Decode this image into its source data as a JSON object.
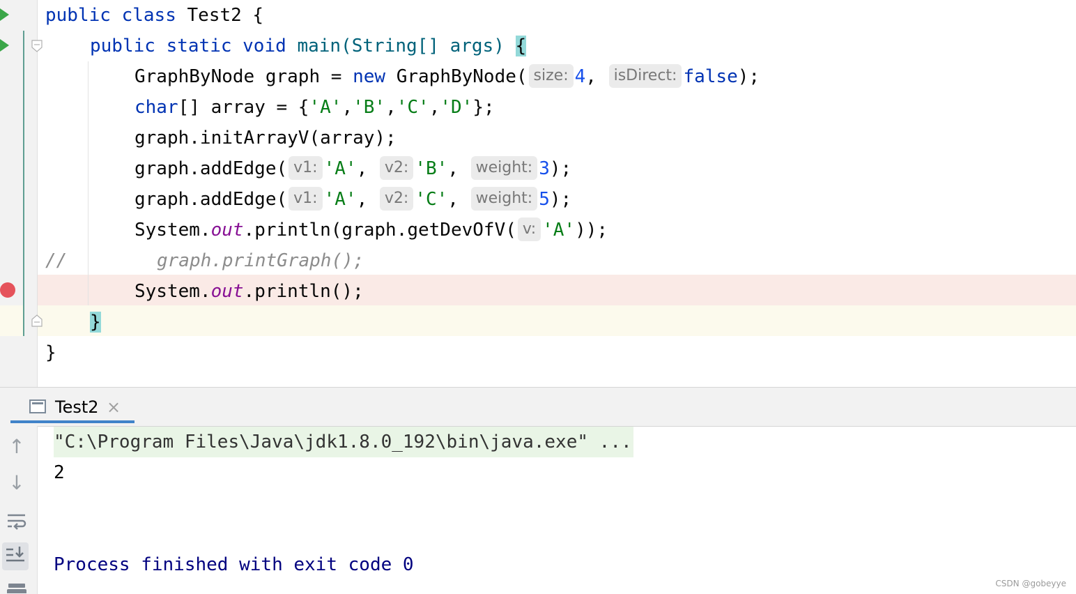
{
  "editor": {
    "line1": {
      "kw1": "public",
      "kw2": "class",
      "name": "Test2 {"
    },
    "line2": {
      "kw1": "public",
      "kw2": "static",
      "kw3": "void",
      "rest": "main(String[] args) ",
      "brace": "{"
    },
    "line3": {
      "pre": "GraphByNode graph = ",
      "kw": "new",
      "call": " GraphByNode(",
      "hint1": "size:",
      "num1": "4",
      "sep": ", ",
      "hint2": "isDirect:",
      "kw2": "false",
      "end": ");"
    },
    "line4": {
      "kw": "char",
      "pre": "[] array = {",
      "s1": "'A'",
      "s2": "'B'",
      "s3": "'C'",
      "s4": "'D'",
      "comma": ",",
      "end": "};"
    },
    "line5": {
      "text": "graph.initArrayV(array);"
    },
    "line6": {
      "pre": "graph.addEdge(",
      "h1": "v1:",
      "a1": "'A'",
      "h2": "v2:",
      "a2": "'B'",
      "h3": "weight:",
      "a3": "3",
      "comma": ", ",
      "end": ");"
    },
    "line7": {
      "pre": "graph.addEdge(",
      "h1": "v1:",
      "a1": "'A'",
      "h2": "v2:",
      "a2": "'C'",
      "h3": "weight:",
      "a3": "5",
      "comma": ", ",
      "end": ");"
    },
    "line8": {
      "pre": "System.",
      "fld": "out",
      "mid": ".println(graph.getDevOfV(",
      "h1": "v:",
      "a1": "'A'",
      "end": "));"
    },
    "line9": {
      "slashes": "//",
      "text": "graph.printGraph();"
    },
    "line10": {
      "pre": "System.",
      "fld": "out",
      "end": ".println();"
    },
    "line11": {
      "brace": "}"
    },
    "line12": {
      "brace": "}"
    }
  },
  "run_panel": {
    "tab_label": "Test2",
    "tab_close": "×",
    "console": {
      "cmd": "\"C:\\Program Files\\Java\\jdk1.8.0_192\\bin\\java.exe\" ...",
      "output": "2",
      "finish": "Process finished with exit code 0"
    },
    "toolbar_icons": [
      "arrow-up-icon",
      "arrow-down-icon",
      "soft-wrap-icon",
      "scroll-to-end-icon",
      "print-icon"
    ]
  },
  "watermark": "CSDN @gobeyye",
  "colors": {
    "keyword": "#0033b3",
    "string": "#067d17",
    "number": "#1750eb",
    "field": "#871094",
    "comment": "#8c8c8c",
    "breakpoint": "#e5535b",
    "run": "#3aa648"
  }
}
